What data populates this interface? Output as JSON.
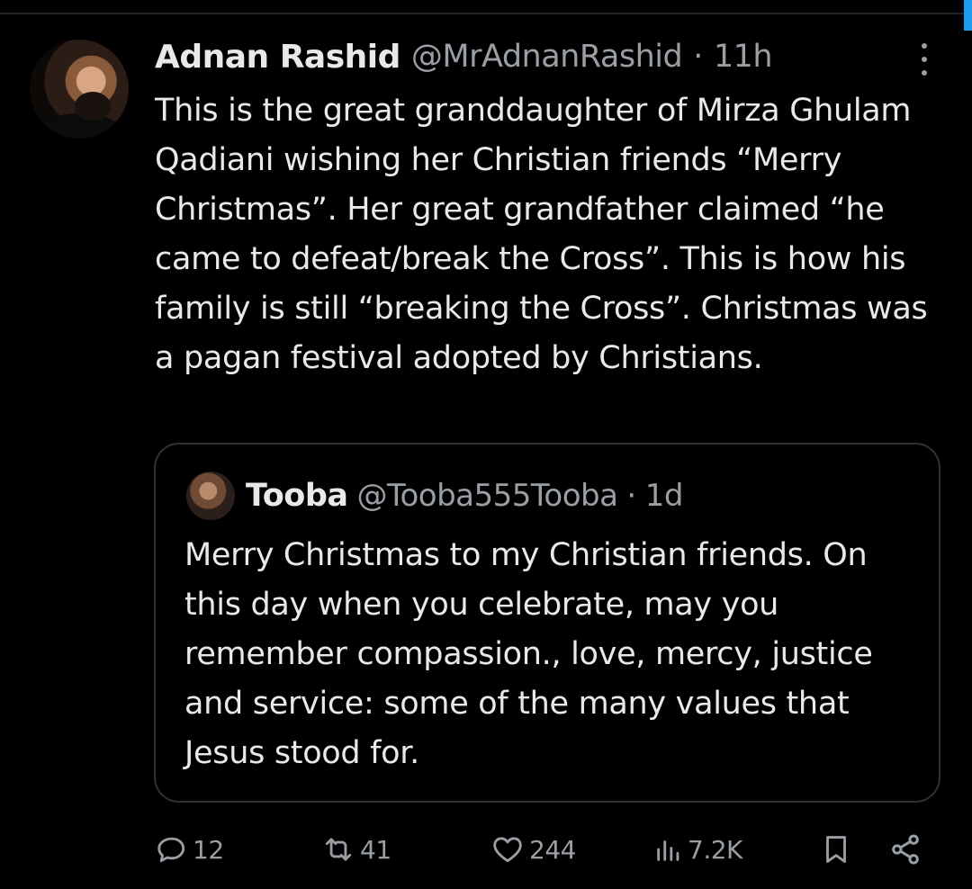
{
  "colors": {
    "background": "#000000",
    "text_primary": "#e7e9ea",
    "text_secondary": "#9a9fa5",
    "border": "#2f3336",
    "accent": "#1d9bf0"
  },
  "tweet": {
    "author": {
      "name": "Adnan Rashid",
      "handle": "@MrAdnanRashid",
      "separator": "·",
      "time": "11h"
    },
    "more_icon": "more-vertical-icon",
    "text": "This is the great granddaughter of Mirza Ghulam Qadiani wishing her Christian friends “Merry Christmas”. Her great grandfather claimed “he came to defeat/break the Cross”. This is how his family is still “breaking the Cross”. Christmas was a pagan festival adopted by Christians."
  },
  "quote": {
    "author": {
      "name": "Tooba",
      "handle": "@Tooba555Tooba",
      "separator": "·",
      "time": "1d"
    },
    "text": "Merry Christmas to my Christian friends. On this day when you celebrate, may you remember  compassion., love, mercy, justice and service: some of the many values that Jesus stood for."
  },
  "actions": {
    "reply": {
      "icon": "reply-icon",
      "count": "12"
    },
    "repost": {
      "icon": "repost-icon",
      "count": "41"
    },
    "like": {
      "icon": "heart-icon",
      "count": "244"
    },
    "views": {
      "icon": "views-icon",
      "count": "7.2K"
    },
    "bookmark": {
      "icon": "bookmark-icon"
    },
    "share": {
      "icon": "share-icon"
    }
  }
}
